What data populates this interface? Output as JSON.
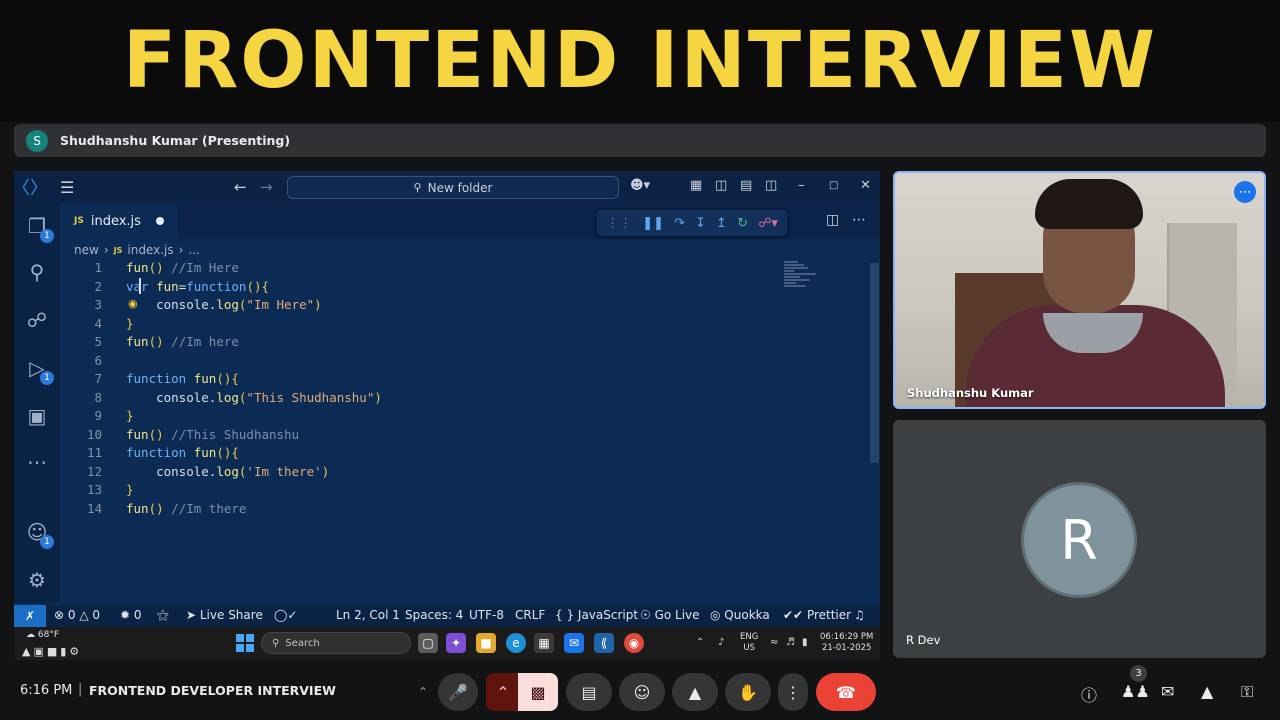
{
  "banner": {
    "title": "FRONTEND INTERVIEW"
  },
  "presenting": {
    "avatar_letter": "S",
    "text": "Shudhanshu Kumar (Presenting)"
  },
  "vscode": {
    "search_text": "New folder",
    "tab": {
      "file_icon": "JS",
      "filename": "index.js"
    },
    "breadcrumb": {
      "folder": "new",
      "file_icon": "JS",
      "file": "index.js",
      "more": "..."
    },
    "activity_badges": {
      "explorer": "1",
      "run": "1",
      "accounts": "1"
    },
    "lines": [
      {
        "n": "1",
        "text": "fun() //Im Here"
      },
      {
        "n": "2",
        "text": "var fun=function(){"
      },
      {
        "n": "3",
        "text": "    console.log(\"Im Here\")"
      },
      {
        "n": "4",
        "text": "}"
      },
      {
        "n": "5",
        "text": "fun() //Im here"
      },
      {
        "n": "6",
        "text": ""
      },
      {
        "n": "7",
        "text": "function fun(){"
      },
      {
        "n": "8",
        "text": "    console.log(\"This Shudhanshu\")"
      },
      {
        "n": "9",
        "text": "}"
      },
      {
        "n": "10",
        "text": "fun() //This Shudhanshu"
      },
      {
        "n": "11",
        "text": "function fun(){"
      },
      {
        "n": "12",
        "text": "    console.log('Im there')"
      },
      {
        "n": "13",
        "text": "}"
      },
      {
        "n": "14",
        "text": "fun() //Im there"
      }
    ],
    "status": {
      "errors": "0",
      "warnings": "0",
      "ports": "0",
      "live_share": "Live Share",
      "position": "Ln 2, Col 1",
      "spaces": "Spaces: 4",
      "encoding": "UTF-8",
      "eol": "CRLF",
      "language": "JavaScript",
      "go_live": "Go Live",
      "quokka": "Quokka",
      "prettier": "Prettier"
    }
  },
  "taskbar": {
    "weather": "68°F",
    "search_placeholder": "Search",
    "lang_top": "ENG",
    "lang_bottom": "US",
    "clock_time": "06:16:29 PM",
    "clock_date": "21-01-2025"
  },
  "participants": {
    "presenter_name": "Shudhanshu Kumar",
    "second_avatar_letter": "R",
    "second_name": "R Dev"
  },
  "meet": {
    "time": "6:16 PM",
    "separator": "|",
    "meeting_title": "FRONTEND DEVELOPER INTERVIEW",
    "people_count": "3"
  },
  "colors": {
    "banner_text": "#f6d542",
    "editor_bg": "#0b2b55",
    "end_call": "#ea4335",
    "cam_off": "#f9dedc",
    "active_tile_border": "#8ab4f8"
  }
}
